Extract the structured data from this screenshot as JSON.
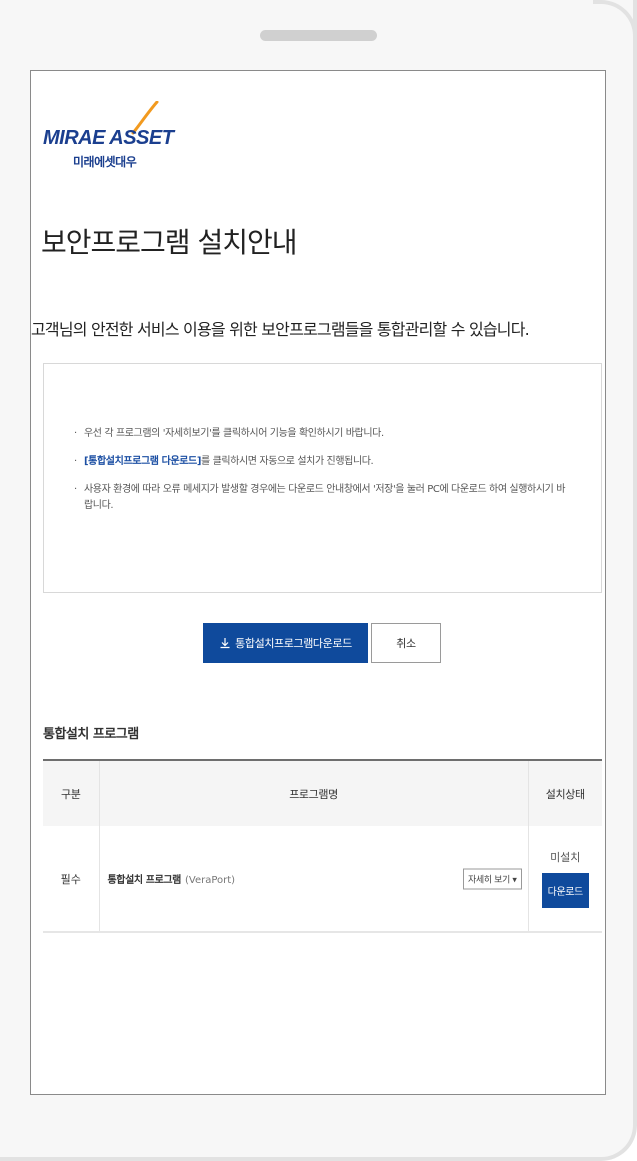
{
  "logo": {
    "brand": "MIRAE ASSET",
    "brand_sub": "미래에셋대우",
    "brand_color": "#1b3f8f",
    "swoosh_color": "#f29a1f"
  },
  "page": {
    "title": "보안프로그램 설치안내",
    "subtitle": "고객님의 안전한 서비스 이용을 위한 보안프로그램들을 통합관리할 수 있습니다."
  },
  "notice": {
    "items": [
      {
        "prefix": "",
        "link": "",
        "text": "우선 각 프로그램의 '자세히보기'를 클릭하시어 기능을 확인하시기 바랍니다."
      },
      {
        "prefix": "",
        "link": "[통합설치프로그램 다운로드]",
        "text": "를 클릭하시면 자동으로 설치가 진행됩니다."
      },
      {
        "prefix": "",
        "link": "",
        "text": "사용자 환경에 따라 오류 메세지가 발생할 경우에는 다운로드 안내창에서 '저장'을 눌러 PC에 다운로드 하여 실행하시기 바랍니다."
      }
    ]
  },
  "buttons": {
    "download_icon": "download-icon",
    "download_label": "통합설치프로그램다운로드",
    "cancel_label": "취소",
    "accent_color": "#0f4a9c"
  },
  "section": {
    "title": "통합설치 프로그램"
  },
  "table": {
    "headers": [
      "구분",
      "프로그램명",
      "설치상태"
    ],
    "rows": [
      {
        "type": "필수",
        "program_name": "통합설치 프로그램",
        "vendor": "(VeraPort)",
        "detail_label": "자세히 보기 ▾",
        "status": "미설치",
        "action_label": "다운로드"
      }
    ]
  }
}
